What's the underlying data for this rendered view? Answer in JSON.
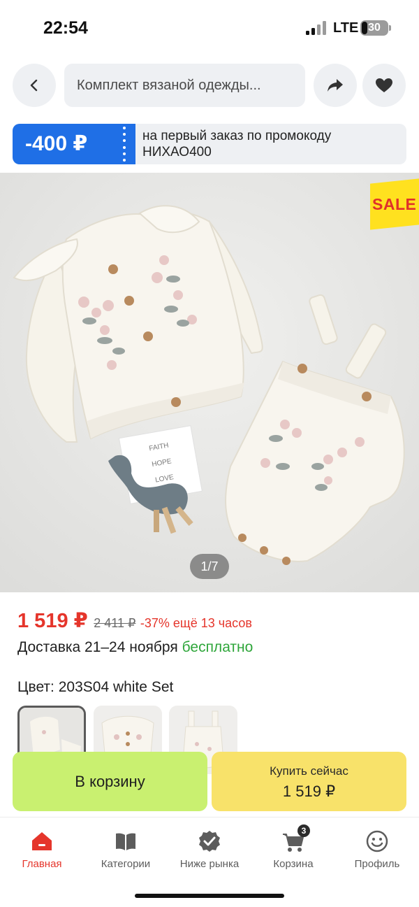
{
  "status_bar": {
    "time": "22:54",
    "network": "LTE",
    "battery": "30"
  },
  "header": {
    "search_text": "Комплект вязаной одежды...",
    "icons": [
      "chevron-left-icon",
      "share-arrow-icon",
      "heart-icon"
    ]
  },
  "promo": {
    "amount": "-400 ₽",
    "text_line1": "на первый заказ по промокоду",
    "text_line2": "НИХАО400"
  },
  "gallery": {
    "sale_label": "SALE",
    "counter": "1/7",
    "card_text": [
      "FAITH",
      "HOPE",
      "LOVE"
    ]
  },
  "price": {
    "current": "1 519 ₽",
    "old": "2 411 ₽",
    "discount": "-37% ещё 13 часов"
  },
  "delivery": {
    "text": "Доставка 21–24 ноября",
    "free": "бесплатно"
  },
  "variant": {
    "label": "Цвет: 203S04 white Set",
    "thumbnails": [
      "Set",
      "Cardigan",
      "Romper"
    ],
    "selected": 0
  },
  "actions": {
    "cart_label": "В корзину",
    "buy_label": "Купить сейчас",
    "buy_price": "1 519 ₽"
  },
  "bottom_nav": {
    "items": [
      {
        "label": "Главная",
        "icon": "home-icon",
        "active": true
      },
      {
        "label": "Категории",
        "icon": "catalog-icon",
        "active": false
      },
      {
        "label": "Ниже рынка",
        "icon": "badge-check-icon",
        "active": false
      },
      {
        "label": "Корзина",
        "icon": "cart-icon",
        "active": false
      },
      {
        "label": "Профиль",
        "icon": "profile-smile-icon",
        "active": false
      }
    ],
    "cart_count": "3"
  },
  "colors": {
    "accent_red": "#e5352b",
    "promo_blue": "#1f6fe6",
    "cart_green": "#c9f070",
    "buy_yellow": "#f8e26a",
    "free_green": "#2fa63b"
  }
}
